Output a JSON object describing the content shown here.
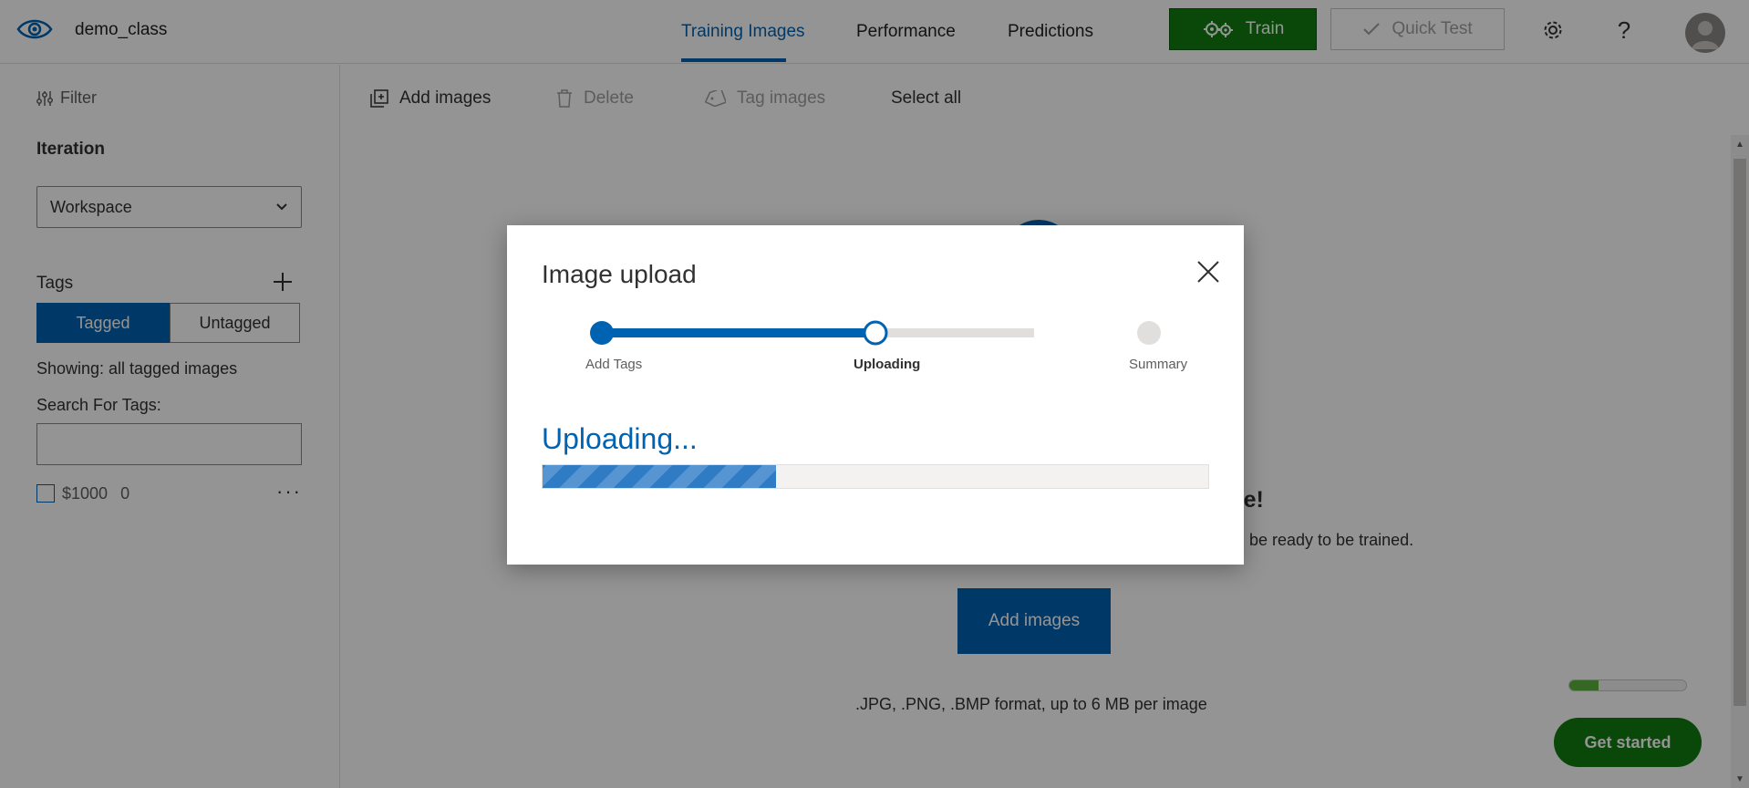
{
  "header": {
    "project_name": "demo_class",
    "tabs": [
      {
        "label": "Training Images",
        "active": true
      },
      {
        "label": "Performance",
        "active": false
      },
      {
        "label": "Predictions",
        "active": false
      }
    ],
    "train_label": "Train",
    "quick_test_label": "Quick Test",
    "help_glyph": "?"
  },
  "sidebar": {
    "filter_label": "Filter",
    "iteration_heading": "Iteration",
    "iteration_selected": "Workspace",
    "tags_heading": "Tags",
    "tagged_label": "Tagged",
    "untagged_label": "Untagged",
    "showing_text": "Showing: all tagged images",
    "search_label": "Search For Tags:",
    "search_value": "",
    "tags": [
      {
        "name": "$1000",
        "count": "0"
      }
    ]
  },
  "toolbar": {
    "add_images": "Add images",
    "delete": "Delete",
    "tag_images": "Tag images",
    "select_all": "Select all"
  },
  "main": {
    "empty_title_partial": "ere!",
    "empty_subtitle_partial": "will be ready to be trained.",
    "add_images_button": "Add images",
    "format_text": ".JPG, .PNG, .BMP format, up to 6 MB per image",
    "mini_progress_fraction": 0.25,
    "get_started_label": "Get started"
  },
  "modal": {
    "title": "Image upload",
    "steps": [
      {
        "label": "Add Tags",
        "state": "complete"
      },
      {
        "label": "Uploading",
        "state": "current"
      },
      {
        "label": "Summary",
        "state": "pending"
      }
    ],
    "status_text": "Uploading...",
    "progress_fraction": 0.35
  },
  "colors": {
    "accent": "#0063b1",
    "train_green": "#107c10",
    "overlay": "rgba(0,0,0,0.42)"
  },
  "icons": {
    "logo": "eye-icon",
    "train": "gears-icon",
    "quick_test": "check-icon",
    "settings": "gear-icon",
    "help": "question-icon",
    "filter": "sliders-icon",
    "add": "plus-icon",
    "add_images": "add-image-icon",
    "delete": "trash-icon",
    "tag": "tag-icon",
    "close": "close-icon"
  }
}
